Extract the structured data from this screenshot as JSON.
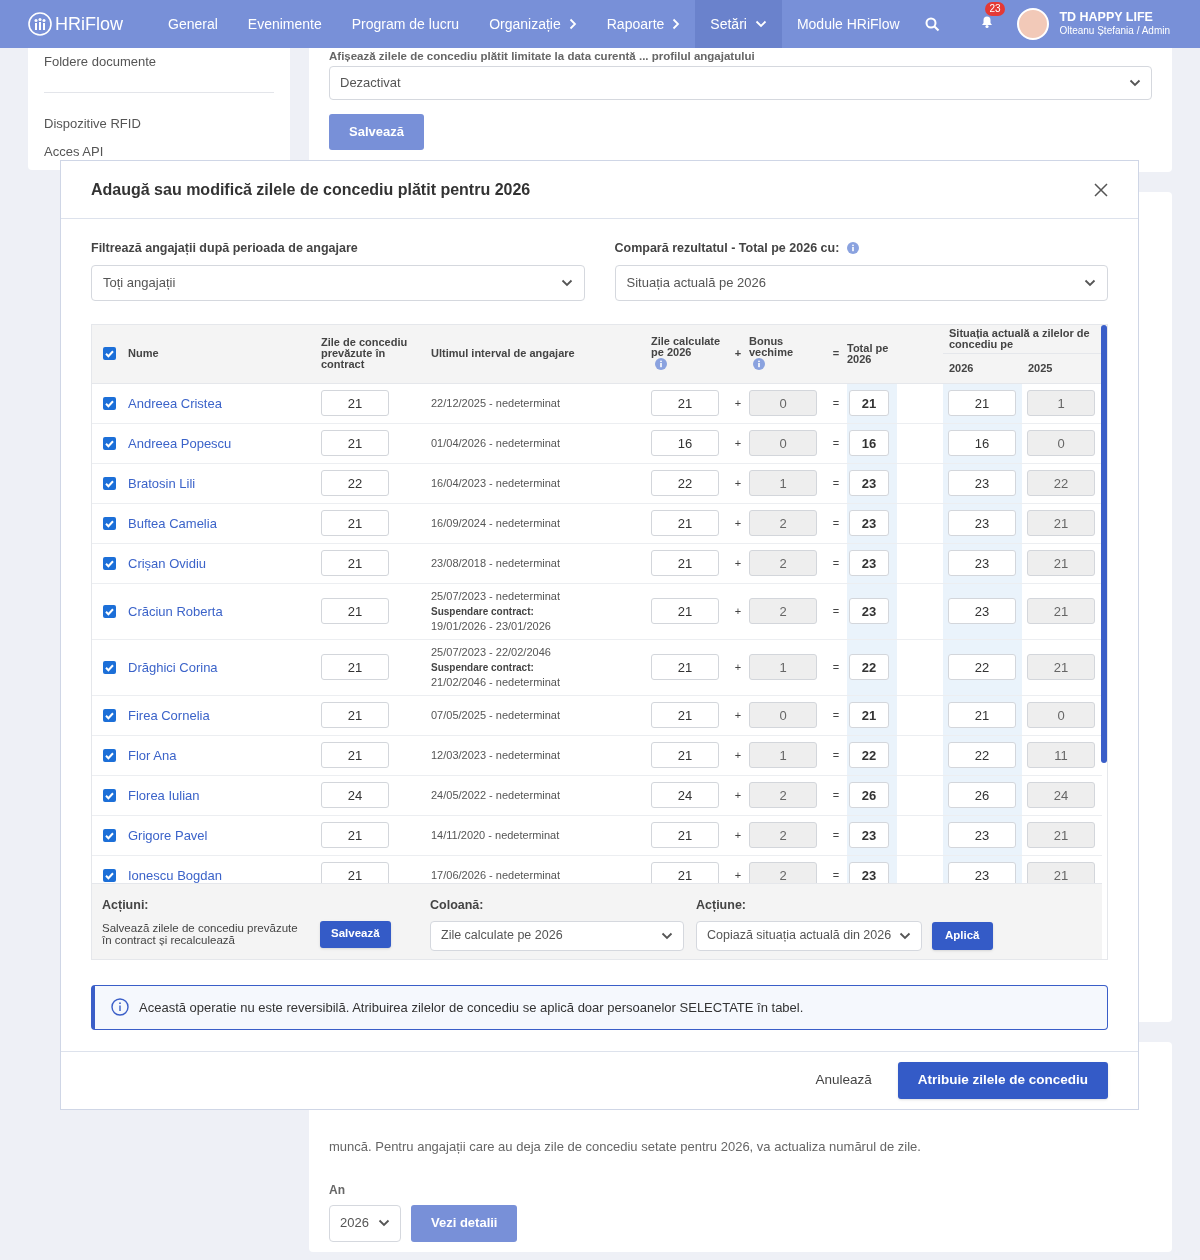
{
  "nav": {
    "brand": "HRiFlow",
    "items": [
      {
        "label": "General",
        "kind": "link",
        "selected": false
      },
      {
        "label": "Evenimente",
        "kind": "link",
        "selected": false
      },
      {
        "label": "Program de lucru",
        "kind": "link",
        "selected": false
      },
      {
        "label": "Organizație",
        "kind": "menu",
        "expanded": false,
        "selected": false
      },
      {
        "label": "Rapoarte",
        "kind": "menu",
        "expanded": false,
        "selected": false
      },
      {
        "label": "Setări",
        "kind": "menu",
        "expanded": true,
        "selected": true
      },
      {
        "label": "Module HRiFlow",
        "kind": "link",
        "selected": false
      }
    ],
    "notifications": "23",
    "company": "TD HAPPY LIFE",
    "user": "Olteanu Ștefania / Admin"
  },
  "background": {
    "sidebar_items": [
      "Foldere documente",
      "Dispozitive RFID",
      "Acces API"
    ],
    "setting_label": "Afișează zilele de concediu plătit limitate la data curentă ... profilul angajatului",
    "setting_value": "Dezactivat",
    "save_button": "Salvează",
    "paragraph": "muncă. Pentru angajații care au deja zile de concediu setate pentru 2026, va actualiza numărul de zile.",
    "year_label": "An",
    "year_value": "2026",
    "details_button": "Vezi detalii"
  },
  "modal": {
    "title": "Adaugă sau modifică zilele de concediu plătit pentru 2026",
    "filter": {
      "label": "Filtrează angajații după perioada de angajare",
      "value": "Toți angajații"
    },
    "compare": {
      "label": "Compară rezultatul - Total pe 2026 cu:",
      "value": "Situația actuală pe 2026"
    },
    "table": {
      "all_checked": true,
      "columns": [
        {
          "label": "Nume"
        },
        {
          "label": "Zile de concediu prevăzute în contract",
          "info": false,
          "disabled": false
        },
        {
          "label": "Ultimul interval de angajare"
        },
        {
          "label": "Zile calculate pe 2026",
          "info": true,
          "disabled": false
        },
        {
          "label": "+"
        },
        {
          "label": "Bonus vechime",
          "info": true,
          "disabled": true
        },
        {
          "label": "="
        },
        {
          "label": "Total pe 2026",
          "info": false,
          "disabled": false
        }
      ],
      "group": {
        "label": "Situația actuală a zilelor de concediu pe",
        "columns": [
          {
            "label": "2026",
            "disabled": false
          },
          {
            "label": "2025",
            "disabled": true
          }
        ]
      },
      "rows": [
        {
          "checked": true,
          "name": "Andreea Cristea",
          "contract": "21",
          "interval": [
            {
              "kind": "text",
              "text": "22/12/2025 - nedeterminat"
            }
          ],
          "calculated": "21",
          "plus": "+",
          "bonus": "0",
          "equals": "=",
          "total": "21",
          "actual": [
            "21",
            "1"
          ]
        },
        {
          "checked": true,
          "name": "Andreea Popescu",
          "contract": "21",
          "interval": [
            {
              "kind": "text",
              "text": "01/04/2026 - nedeterminat"
            }
          ],
          "calculated": "16",
          "plus": "+",
          "bonus": "0",
          "equals": "=",
          "total": "16",
          "actual": [
            "16",
            "0"
          ]
        },
        {
          "checked": true,
          "name": "Bratosin Lili",
          "contract": "22",
          "interval": [
            {
              "kind": "text",
              "text": "16/04/2023 - nedeterminat"
            }
          ],
          "calculated": "22",
          "plus": "+",
          "bonus": "1",
          "equals": "=",
          "total": "23",
          "actual": [
            "23",
            "22"
          ]
        },
        {
          "checked": true,
          "name": "Buftea Camelia",
          "contract": "21",
          "interval": [
            {
              "kind": "text",
              "text": "16/09/2024 - nedeterminat"
            }
          ],
          "calculated": "21",
          "plus": "+",
          "bonus": "2",
          "equals": "=",
          "total": "23",
          "actual": [
            "23",
            "21"
          ]
        },
        {
          "checked": true,
          "name": "Crișan Ovidiu",
          "contract": "21",
          "interval": [
            {
              "kind": "text",
              "text": "23/08/2018 - nedeterminat"
            }
          ],
          "calculated": "21",
          "plus": "+",
          "bonus": "2",
          "equals": "=",
          "total": "23",
          "actual": [
            "23",
            "21"
          ]
        },
        {
          "checked": true,
          "name": "Crăciun Roberta",
          "contract": "21",
          "interval": [
            {
              "kind": "text",
              "text": "25/07/2023 - nedeterminat"
            },
            {
              "kind": "label",
              "text": "Suspendare contract:"
            },
            {
              "kind": "text",
              "text": "19/01/2026 - 23/01/2026"
            }
          ],
          "calculated": "21",
          "plus": "+",
          "bonus": "2",
          "equals": "=",
          "total": "23",
          "actual": [
            "23",
            "21"
          ]
        },
        {
          "checked": true,
          "name": "Drăghici Corina",
          "contract": "21",
          "interval": [
            {
              "kind": "text",
              "text": "25/07/2023 - 22/02/2046"
            },
            {
              "kind": "label",
              "text": "Suspendare contract:"
            },
            {
              "kind": "text",
              "text": "21/02/2046 - nedeterminat"
            }
          ],
          "calculated": "21",
          "plus": "+",
          "bonus": "1",
          "equals": "=",
          "total": "22",
          "actual": [
            "22",
            "21"
          ]
        },
        {
          "checked": true,
          "name": "Firea Cornelia",
          "contract": "21",
          "interval": [
            {
              "kind": "text",
              "text": "07/05/2025 - nedeterminat"
            }
          ],
          "calculated": "21",
          "plus": "+",
          "bonus": "0",
          "equals": "=",
          "total": "21",
          "actual": [
            "21",
            "0"
          ]
        },
        {
          "checked": true,
          "name": "Flor Ana",
          "contract": "21",
          "interval": [
            {
              "kind": "text",
              "text": "12/03/2023 - nedeterminat"
            }
          ],
          "calculated": "21",
          "plus": "+",
          "bonus": "1",
          "equals": "=",
          "total": "22",
          "actual": [
            "22",
            "11"
          ]
        },
        {
          "checked": true,
          "name": "Florea Iulian",
          "contract": "24",
          "interval": [
            {
              "kind": "text",
              "text": "24/05/2022 - nedeterminat"
            }
          ],
          "calculated": "24",
          "plus": "+",
          "bonus": "2",
          "equals": "=",
          "total": "26",
          "actual": [
            "26",
            "24"
          ]
        },
        {
          "checked": true,
          "name": "Grigore Pavel",
          "contract": "21",
          "interval": [
            {
              "kind": "text",
              "text": "14/11/2020 - nedeterminat"
            }
          ],
          "calculated": "21",
          "plus": "+",
          "bonus": "2",
          "equals": "=",
          "total": "23",
          "actual": [
            "23",
            "21"
          ]
        },
        {
          "checked": true,
          "name": "Ionescu Bogdan",
          "contract": "21",
          "interval": [
            {
              "kind": "text",
              "text": "17/06/2026 - nedeterminat"
            }
          ],
          "calculated": "21",
          "plus": "+",
          "bonus": "2",
          "equals": "=",
          "total": "23",
          "actual": [
            "23",
            "21"
          ]
        }
      ]
    },
    "actions": {
      "label": "Acțiuni:",
      "description": "Salvează zilele de concediu prevăzute în contract și recalculează",
      "save_button": "Salvează",
      "column_label": "Coloană:",
      "column_value": "Zile calculate pe 2026",
      "action_label": "Acțiune:",
      "action_value": "Copiază situația actuală din 2026",
      "apply_button": "Aplică"
    },
    "info": "Această operatie nu este reversibilă. Atribuirea zilelor de concediu se aplică doar persoanelor SELECTATE în tabel.",
    "cancel_button": "Anulează",
    "submit_button": "Atribuie zilele de concediu"
  }
}
